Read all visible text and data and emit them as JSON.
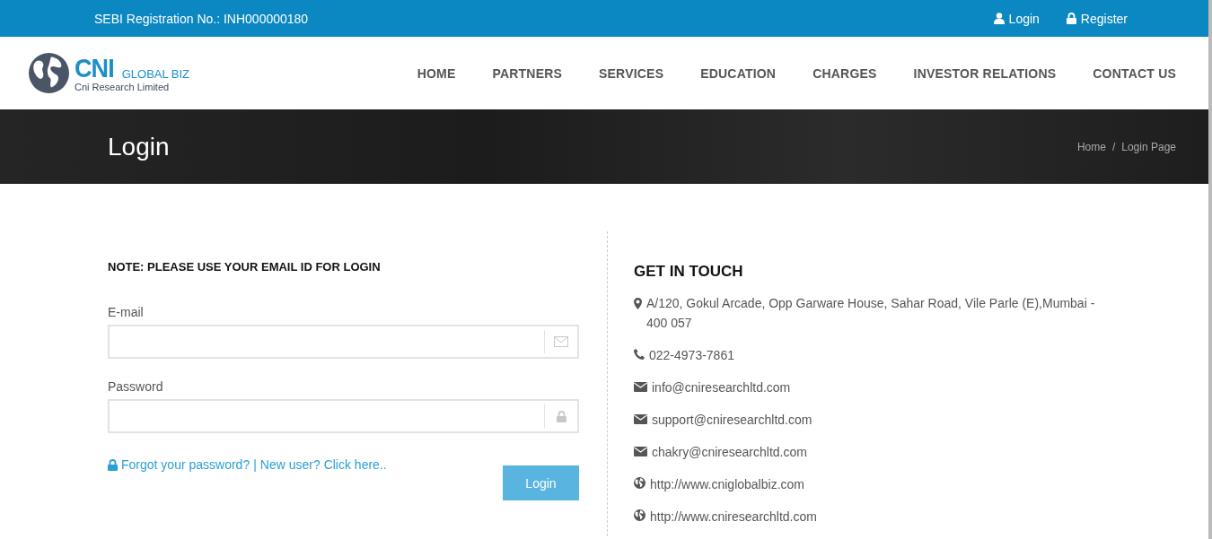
{
  "top_bar": {
    "registration": "SEBI Registration No.: INH000000180",
    "links": [
      {
        "kind": "user",
        "label": "Login"
      },
      {
        "kind": "lock",
        "label": "Register"
      }
    ]
  },
  "logo": {
    "mark": "CNI",
    "tagline": "GLOBAL BIZ",
    "company": "Cni Research Limited"
  },
  "nav": [
    {
      "label": "HOME"
    },
    {
      "label": "PARTNERS"
    },
    {
      "label": "SERVICES"
    },
    {
      "label": "EDUCATION"
    },
    {
      "label": "CHARGES"
    },
    {
      "label": "INVESTOR RELATIONS"
    },
    {
      "label": "CONTACT US"
    }
  ],
  "banner": {
    "title": "Login",
    "breadcrumb": [
      "Home",
      "Login Page"
    ],
    "separator": "/"
  },
  "login_form": {
    "note": "NOTE: PLEASE USE YOUR EMAIL ID FOR LOGIN",
    "fields": [
      {
        "kind": "email",
        "label": "E-mail"
      },
      {
        "kind": "password",
        "label": "Password"
      }
    ],
    "forgot_link": "Forgot your password?",
    "divider": "|",
    "new_user_link": "New user? Click here..",
    "submit": "Login"
  },
  "contact": {
    "title": "GET IN TOUCH",
    "items": [
      {
        "kind": "location",
        "text": "A/120, Gokul Arcade, Opp Garware House, Sahar Road, Vile Parle (E),Mumbai - 400 057"
      },
      {
        "kind": "phone",
        "text": "022-4973-7861"
      },
      {
        "kind": "email",
        "text": "info@cniresearchltd.com"
      },
      {
        "kind": "email",
        "text": "support@cniresearchltd.com"
      },
      {
        "kind": "email",
        "text": "chakry@cniresearchltd.com"
      },
      {
        "kind": "web",
        "text": "http://www.cniglobalbiz.com"
      },
      {
        "kind": "web",
        "text": "http://www.cniresearchltd.com"
      }
    ]
  }
}
